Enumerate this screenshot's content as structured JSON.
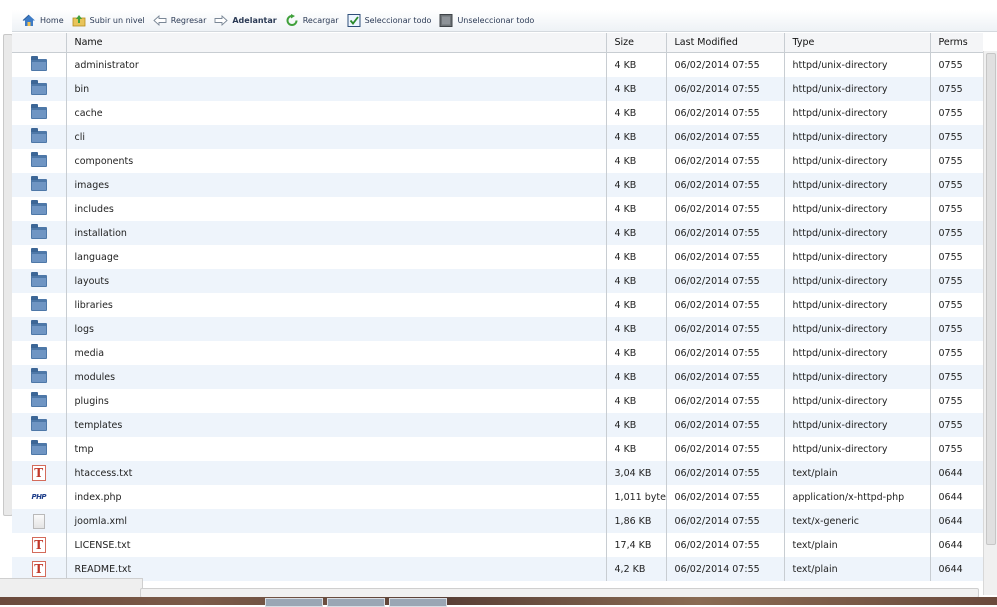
{
  "toolbar": {
    "items": [
      {
        "label": "Home",
        "icon": "home-icon"
      },
      {
        "label": "Subir un nivel",
        "icon": "folder-up-icon"
      },
      {
        "label": "Regresar",
        "icon": "arrow-left-icon"
      },
      {
        "label": "Adelantar",
        "icon": "arrow-right-icon"
      },
      {
        "label": "Recargar",
        "icon": "reload-icon"
      },
      {
        "label": "Seleccionar todo",
        "icon": "checkbox-checked-icon"
      },
      {
        "label": "Unseleccionar todo",
        "icon": "checkbox-unchecked-icon"
      }
    ]
  },
  "table": {
    "headers": [
      "Name",
      "Size",
      "Last Modified",
      "Type",
      "Perms"
    ],
    "rows": [
      {
        "icon": "folder",
        "name": "administrator",
        "size": "4 KB",
        "modified": "06/02/2014 07:55",
        "type": "httpd/unix-directory",
        "perms": "0755"
      },
      {
        "icon": "folder",
        "name": "bin",
        "size": "4 KB",
        "modified": "06/02/2014 07:55",
        "type": "httpd/unix-directory",
        "perms": "0755"
      },
      {
        "icon": "folder",
        "name": "cache",
        "size": "4 KB",
        "modified": "06/02/2014 07:55",
        "type": "httpd/unix-directory",
        "perms": "0755"
      },
      {
        "icon": "folder",
        "name": "cli",
        "size": "4 KB",
        "modified": "06/02/2014 07:55",
        "type": "httpd/unix-directory",
        "perms": "0755"
      },
      {
        "icon": "folder",
        "name": "components",
        "size": "4 KB",
        "modified": "06/02/2014 07:55",
        "type": "httpd/unix-directory",
        "perms": "0755"
      },
      {
        "icon": "folder",
        "name": "images",
        "size": "4 KB",
        "modified": "06/02/2014 07:55",
        "type": "httpd/unix-directory",
        "perms": "0755"
      },
      {
        "icon": "folder",
        "name": "includes",
        "size": "4 KB",
        "modified": "06/02/2014 07:55",
        "type": "httpd/unix-directory",
        "perms": "0755"
      },
      {
        "icon": "folder",
        "name": "installation",
        "size": "4 KB",
        "modified": "06/02/2014 07:55",
        "type": "httpd/unix-directory",
        "perms": "0755"
      },
      {
        "icon": "folder",
        "name": "language",
        "size": "4 KB",
        "modified": "06/02/2014 07:55",
        "type": "httpd/unix-directory",
        "perms": "0755"
      },
      {
        "icon": "folder",
        "name": "layouts",
        "size": "4 KB",
        "modified": "06/02/2014 07:55",
        "type": "httpd/unix-directory",
        "perms": "0755"
      },
      {
        "icon": "folder",
        "name": "libraries",
        "size": "4 KB",
        "modified": "06/02/2014 07:55",
        "type": "httpd/unix-directory",
        "perms": "0755"
      },
      {
        "icon": "folder",
        "name": "logs",
        "size": "4 KB",
        "modified": "06/02/2014 07:55",
        "type": "httpd/unix-directory",
        "perms": "0755"
      },
      {
        "icon": "folder",
        "name": "media",
        "size": "4 KB",
        "modified": "06/02/2014 07:55",
        "type": "httpd/unix-directory",
        "perms": "0755"
      },
      {
        "icon": "folder",
        "name": "modules",
        "size": "4 KB",
        "modified": "06/02/2014 07:55",
        "type": "httpd/unix-directory",
        "perms": "0755"
      },
      {
        "icon": "folder",
        "name": "plugins",
        "size": "4 KB",
        "modified": "06/02/2014 07:55",
        "type": "httpd/unix-directory",
        "perms": "0755"
      },
      {
        "icon": "folder",
        "name": "templates",
        "size": "4 KB",
        "modified": "06/02/2014 07:55",
        "type": "httpd/unix-directory",
        "perms": "0755"
      },
      {
        "icon": "folder",
        "name": "tmp",
        "size": "4 KB",
        "modified": "06/02/2014 07:55",
        "type": "httpd/unix-directory",
        "perms": "0755"
      },
      {
        "icon": "text",
        "name": "htaccess.txt",
        "size": "3,04 KB",
        "modified": "06/02/2014 07:55",
        "type": "text/plain",
        "perms": "0644"
      },
      {
        "icon": "php",
        "name": "index.php",
        "size": "1,011 byte",
        "modified": "06/02/2014 07:55",
        "type": "application/x-httpd-php",
        "perms": "0644"
      },
      {
        "icon": "generic",
        "name": "joomla.xml",
        "size": "1,86 KB",
        "modified": "06/02/2014 07:55",
        "type": "text/x-generic",
        "perms": "0644"
      },
      {
        "icon": "text",
        "name": "LICENSE.txt",
        "size": "17,4 KB",
        "modified": "06/02/2014 07:55",
        "type": "text/plain",
        "perms": "0644"
      },
      {
        "icon": "text",
        "name": "README.txt",
        "size": "4,2 KB",
        "modified": "06/02/2014 07:55",
        "type": "text/plain",
        "perms": "0644"
      }
    ]
  }
}
